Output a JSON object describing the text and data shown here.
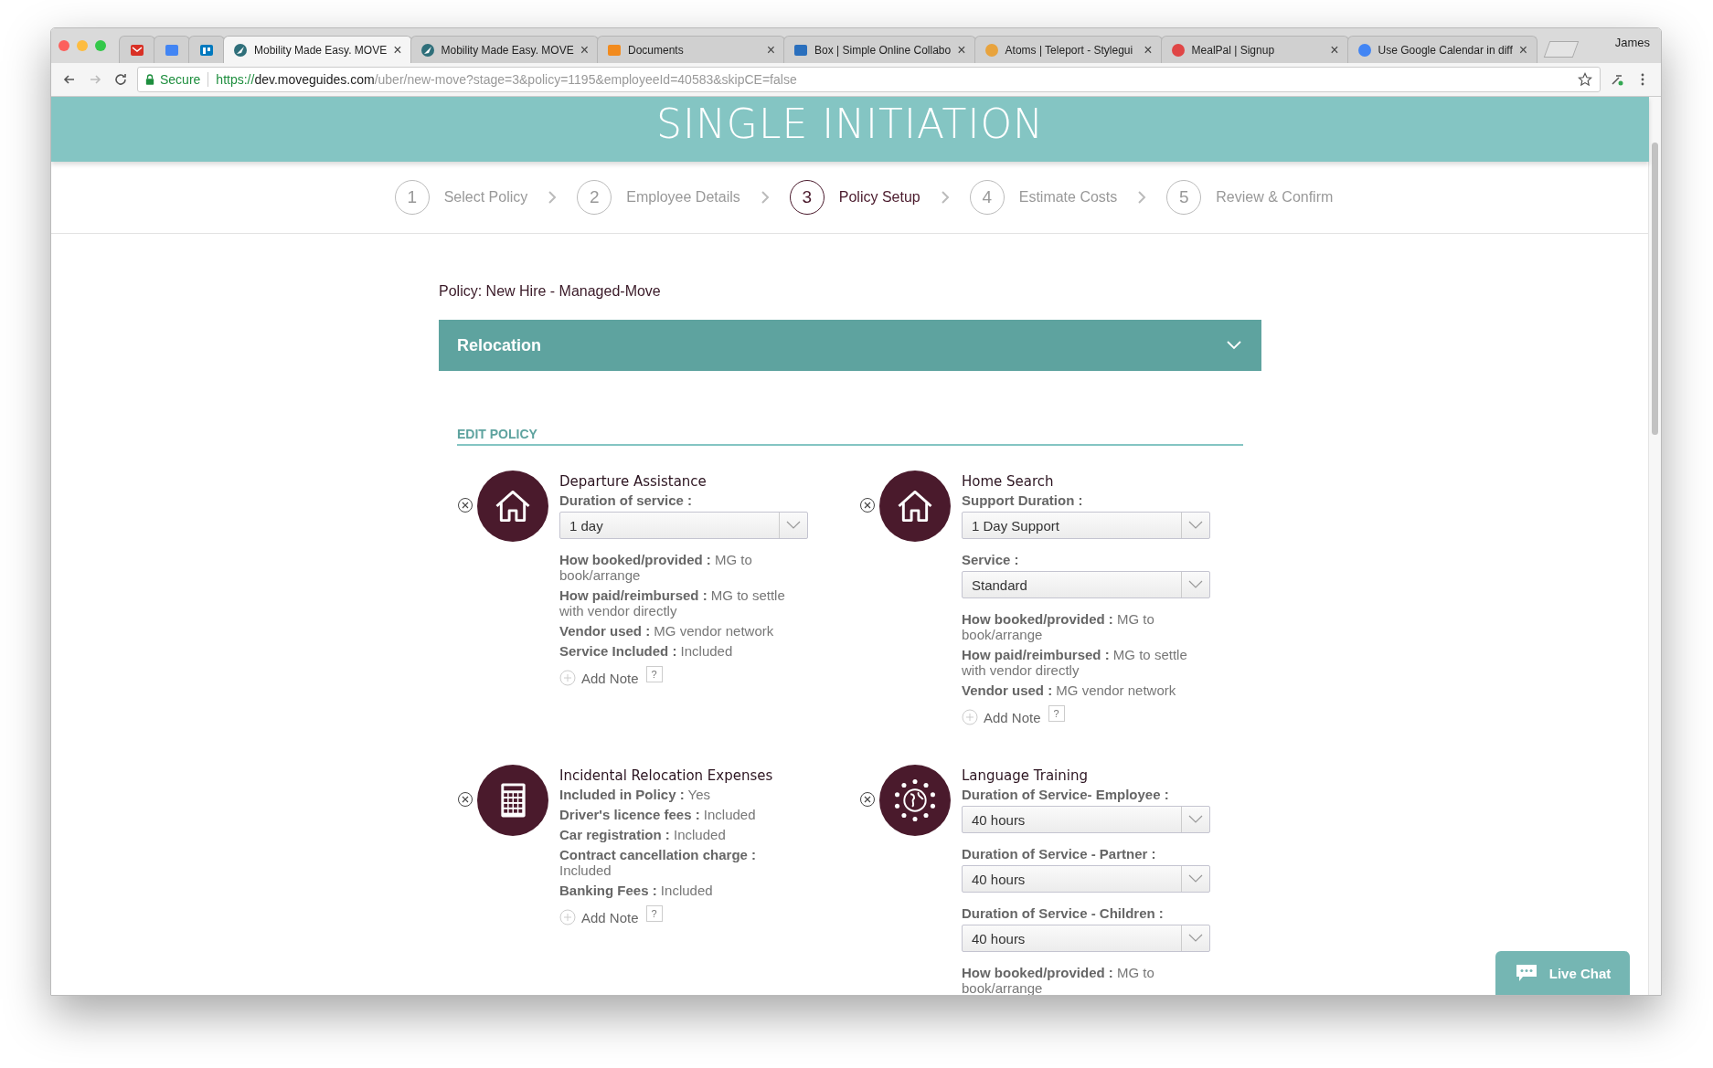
{
  "browser": {
    "tabs": [
      {
        "kind": "mail",
        "selected": false
      },
      {
        "kind": "calendar",
        "selected": false
      },
      {
        "kind": "board",
        "selected": false
      },
      {
        "kind": "compass",
        "title": "Mobility Made Easy. MOVE",
        "close": "×",
        "selected": true
      },
      {
        "kind": "compass",
        "title": "Mobility Made Easy. MOVE",
        "close": "×",
        "selected": false
      },
      {
        "kind": "grid",
        "title": "Documents",
        "close": "×",
        "selected": false
      },
      {
        "kind": "box",
        "title": "Box | Simple Online Collabo",
        "close": "×",
        "selected": false
      },
      {
        "kind": "boat",
        "title": "Atoms | Teleport - Stylegui",
        "close": "×",
        "selected": false
      },
      {
        "kind": "letter",
        "title": "MealPal | Signup",
        "close": "×",
        "selected": false
      },
      {
        "kind": "g",
        "title": "Use Google Calendar in diff",
        "close": "×",
        "selected": false
      }
    ],
    "profile": "James",
    "secure_label": "Secure",
    "url": {
      "scheme": "https://",
      "host": "dev.moveguides.com",
      "path": "/uber/new-move?stage=3&policy=1195&employeeId=40583&skipCE=false"
    }
  },
  "header": {
    "title": "SINGLE INITIATION"
  },
  "steps": [
    {
      "number": "1",
      "label": "Select Policy",
      "selected": false
    },
    {
      "number": "2",
      "label": "Employee Details",
      "selected": false
    },
    {
      "number": "3",
      "label": "Policy Setup",
      "selected": true
    },
    {
      "number": "4",
      "label": "Estimate Costs",
      "selected": false
    },
    {
      "number": "5",
      "label": "Review & Confirm",
      "selected": false
    }
  ],
  "policy_label": "Policy: New Hire - Managed-Move",
  "section": {
    "title": "Relocation",
    "expanded": true
  },
  "edit_policy": "EDIT POLICY",
  "services": [
    {
      "kind": "house",
      "title": "Departure Assistance",
      "add_note": "Add Note",
      "help": "?",
      "fields": [
        {
          "kind": "select",
          "label": "Duration of service :",
          "value": "1 day"
        },
        {
          "kind": "info",
          "label": "How booked/provided :",
          "value": "MG to book/arrange"
        },
        {
          "kind": "info",
          "label": "How paid/reimbursed :",
          "value": "MG to settle with vendor directly"
        },
        {
          "kind": "info",
          "label": "Vendor used :",
          "value": "MG vendor network"
        },
        {
          "kind": "info",
          "label": "Service Included :",
          "value": "Included"
        }
      ]
    },
    {
      "kind": "house",
      "title": "Home Search",
      "add_note": "Add Note",
      "help": "?",
      "fields": [
        {
          "kind": "select",
          "label": "Support Duration :",
          "value": "1 Day Support"
        },
        {
          "kind": "select",
          "label": "Service :",
          "value": "Standard"
        },
        {
          "kind": "info",
          "label": "How booked/provided :",
          "value": "MG to book/arrange"
        },
        {
          "kind": "info",
          "label": "How paid/reimbursed :",
          "value": "MG to settle with vendor directly"
        },
        {
          "kind": "info",
          "label": "Vendor used :",
          "value": "MG vendor network"
        }
      ]
    },
    {
      "kind": "calculator",
      "title": "Incidental Relocation Expenses",
      "add_note": "Add Note",
      "help": "?",
      "fields": [
        {
          "kind": "info",
          "label": "Included in Policy :",
          "value": "Yes"
        },
        {
          "kind": "info",
          "label": "Driver's licence fees :",
          "value": "Included"
        },
        {
          "kind": "info",
          "label": "Car registration :",
          "value": "Included"
        },
        {
          "kind": "info",
          "label": "Contract cancellation charge :",
          "value": "Included"
        },
        {
          "kind": "info",
          "label": "Banking Fees :",
          "value": "Included"
        }
      ]
    },
    {
      "kind": "globe",
      "title": "Language Training",
      "fields": [
        {
          "kind": "select",
          "label": "Duration of Service- Employee :",
          "value": "40 hours"
        },
        {
          "kind": "select",
          "label": "Duration of Service - Partner :",
          "value": "40 hours"
        },
        {
          "kind": "select",
          "label": "Duration of Service - Children :",
          "value": "40 hours"
        },
        {
          "kind": "info",
          "label": "How booked/provided :",
          "value": "MG to book/arrange"
        }
      ]
    }
  ],
  "live_chat": "Live Chat"
}
